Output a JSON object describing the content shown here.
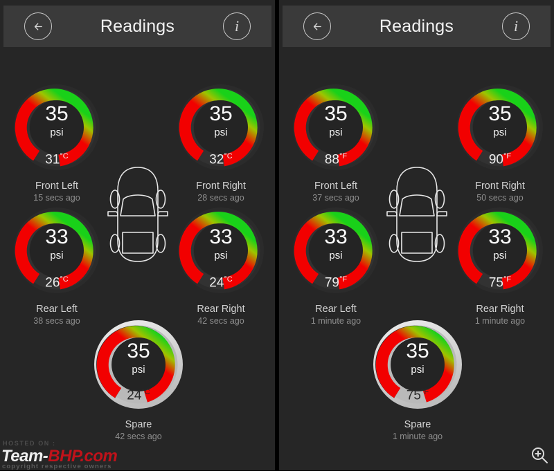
{
  "app": {
    "title": "Readings",
    "back_icon": "arrow-left-icon",
    "info_icon": "info-icon"
  },
  "colors": {
    "panel_bg": "#262626",
    "header_bg": "#3a3a3a",
    "arc_red": "#f20000",
    "arc_green": "#19d119",
    "ring_track": "#323232",
    "spare_ring": "#d6d6d6",
    "text_primary": "#fdfdfd",
    "text_secondary": "#d2d2d2",
    "text_muted": "#8e8e8e"
  },
  "panels": [
    {
      "id": "panel-celsius",
      "title": "Readings",
      "unit_temp": "°C",
      "readings": [
        {
          "position": "front-left",
          "value": "35",
          "unit": "psi",
          "temp": "31",
          "temp_unit": "°C",
          "label": "Front Left",
          "ago": "15 secs ago",
          "arc_pct": 97,
          "highlight": false
        },
        {
          "position": "front-right",
          "value": "35",
          "unit": "psi",
          "temp": "32",
          "temp_unit": "°C",
          "label": "Front Right",
          "ago": "28 secs ago",
          "arc_pct": 97,
          "highlight": false
        },
        {
          "position": "rear-left",
          "value": "33",
          "unit": "psi",
          "temp": "26",
          "temp_unit": "°C",
          "label": "Rear Left",
          "ago": "38 secs ago",
          "arc_pct": 97,
          "highlight": false
        },
        {
          "position": "rear-right",
          "value": "33",
          "unit": "psi",
          "temp": "24",
          "temp_unit": "°C",
          "label": "Rear Right",
          "ago": "42 secs ago",
          "arc_pct": 97,
          "highlight": false
        },
        {
          "position": "spare",
          "value": "35",
          "unit": "psi",
          "temp": "24",
          "temp_unit": "°C",
          "label": "Spare",
          "ago": "42 secs ago",
          "arc_pct": 90,
          "highlight": true
        }
      ]
    },
    {
      "id": "panel-fahrenheit",
      "title": "Readings",
      "unit_temp": "°F",
      "readings": [
        {
          "position": "front-left",
          "value": "35",
          "unit": "psi",
          "temp": "88",
          "temp_unit": "°F",
          "label": "Front Left",
          "ago": "37 secs ago",
          "arc_pct": 97,
          "highlight": false
        },
        {
          "position": "front-right",
          "value": "35",
          "unit": "psi",
          "temp": "90",
          "temp_unit": "°F",
          "label": "Front Right",
          "ago": "50 secs ago",
          "arc_pct": 97,
          "highlight": false
        },
        {
          "position": "rear-left",
          "value": "33",
          "unit": "psi",
          "temp": "79",
          "temp_unit": "°F",
          "label": "Rear Left",
          "ago": "1 minute ago",
          "arc_pct": 97,
          "highlight": false
        },
        {
          "position": "rear-right",
          "value": "33",
          "unit": "psi",
          "temp": "75",
          "temp_unit": "°F",
          "label": "Rear Right",
          "ago": "1 minute ago",
          "arc_pct": 97,
          "highlight": false
        },
        {
          "position": "spare",
          "value": "35",
          "unit": "psi",
          "temp": "75",
          "temp_unit": "°F",
          "label": "Spare",
          "ago": "1 minute ago",
          "arc_pct": 90,
          "highlight": true
        }
      ]
    }
  ],
  "watermark": {
    "hosted": "HOSTED ON :",
    "brand_left": "Team-",
    "brand_right": "BHP",
    "brand_tld": ".com",
    "copyright": "copyright respective owners"
  },
  "zoom_badge": {
    "icon": "zoom-in-icon"
  }
}
